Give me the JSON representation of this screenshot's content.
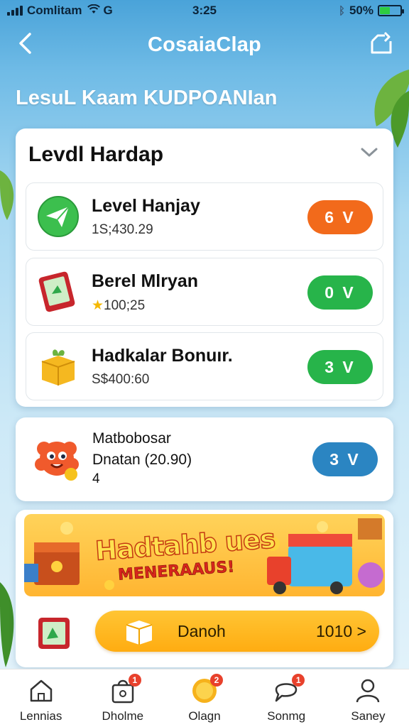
{
  "status_bar": {
    "carrier": "Comlitam",
    "network": "G",
    "time": "3:25",
    "battery": "50%",
    "battery_level": 0.5
  },
  "header": {
    "title": "CosaiaClap",
    "back_icon": "chevron-left-icon",
    "share_icon": "share-icon"
  },
  "section_heading": "LesuL Kaam KUDPOANIan",
  "main_card": {
    "title": "Levdl Hardap",
    "items": [
      {
        "title": "Level Hanjay",
        "subtitle": "1S;430.29",
        "pill": "6 V",
        "pill_color": "#f26a1b",
        "icon": "paper-plane-icon"
      },
      {
        "title": "Berel Mlryan",
        "subtitle": "100;25",
        "pill": "0 V",
        "pill_color": "#27b44a",
        "icon": "tablet-icon",
        "sub_icon": "star-icon"
      },
      {
        "title": "Hadkalar Bonuır.",
        "subtitle": "S$400:60",
        "pill": "3 V",
        "pill_color": "#27b44a",
        "icon": "gift-box-icon"
      }
    ]
  },
  "mascot_card": {
    "title": "Matbobosar",
    "subtitle": "Dnatan (20.90)",
    "count": "4",
    "pill": "3 V",
    "pill_color": "#2b85c2",
    "icon": "mascot-icon"
  },
  "promo": {
    "banner_line1": "Hadtahb ues",
    "banner_line2": "MENERAAUS!",
    "cta_label": "Danoh",
    "cta_value": "1010 >",
    "icon": "tablet-icon",
    "cta_icon": "box-icon"
  },
  "bottom_nav": [
    {
      "label": "Lennias",
      "icon": "home-icon",
      "badge": ""
    },
    {
      "label": "Dholme",
      "icon": "bag-icon",
      "badge": "1"
    },
    {
      "label": "Olagn",
      "icon": "coin-icon",
      "badge": "2"
    },
    {
      "label": "Sonmg",
      "icon": "chat-icon",
      "badge": "1"
    },
    {
      "label": "Saney",
      "icon": "user-icon",
      "badge": ""
    }
  ]
}
